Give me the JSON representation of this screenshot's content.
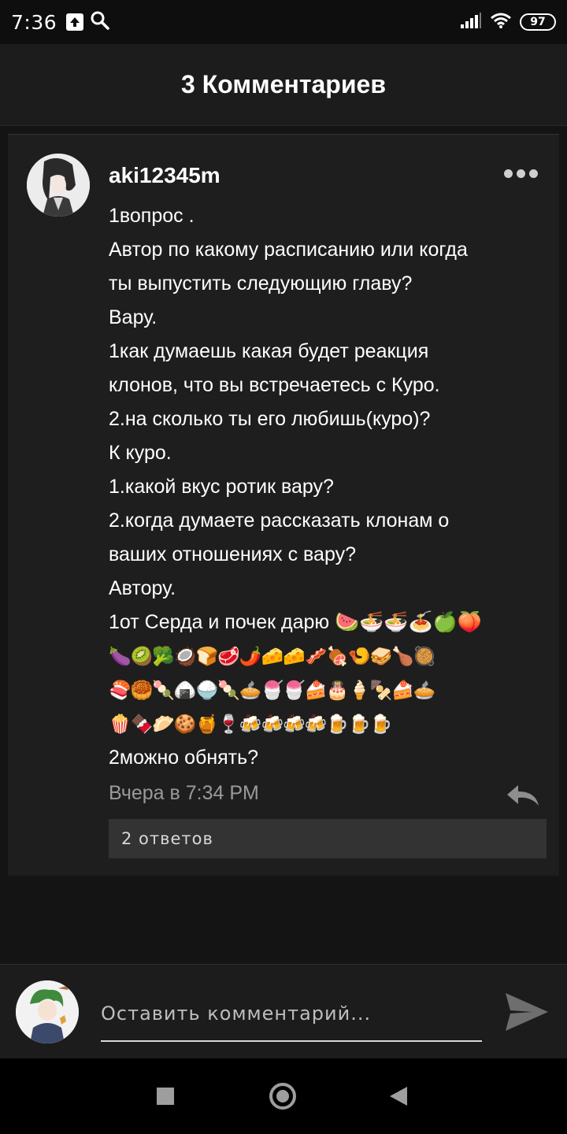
{
  "status_bar": {
    "time": "7:36",
    "battery": "97"
  },
  "header": {
    "title": "3 Комментариев"
  },
  "comment": {
    "username": "aki12345m",
    "lines": [
      "1вопрос .",
      "Автор по какому расписанию или когда",
      "ты выпустить следующию главу?",
      "Вару.",
      "1как думаешь какая будет реакция",
      "клонов, что вы встречаетесь с Куро.",
      "2.на сколько ты его любишь(куро)?",
      "К куро.",
      "1.какой вкус ротик вару?",
      "2.когда думаете рассказать клонам о",
      "ваших отношениях с вару?",
      "Автору.",
      "1от Серда и почек дарю 🍉🍜🍜🍝🍏🍑"
    ],
    "emoji_lines": [
      "🍆🥝🥦🥥🍞🥩🌶️🧀🧀🥓🍖🍤🥪🍗🥘",
      "🍣🥮🍡🍙🍚🍡🥧🍧🍧🍰🎂🍦🍢🍰🥧",
      "🍿🍫🥟🍪🍯🍷🍻🍻🍻🍻🍺🍺🍺"
    ],
    "last_line": "2можно обнять?",
    "timestamp": "Вчера в 7:34 PM",
    "replies_label": "2 ответов"
  },
  "input": {
    "placeholder": "Оставить комментарий..."
  },
  "icons": {
    "upload": "upload-icon",
    "search": "search-icon",
    "signal": "signal-icon",
    "wifi": "wifi-icon",
    "battery": "battery-icon",
    "more": "more-icon",
    "reply": "reply-icon",
    "send": "send-icon"
  }
}
